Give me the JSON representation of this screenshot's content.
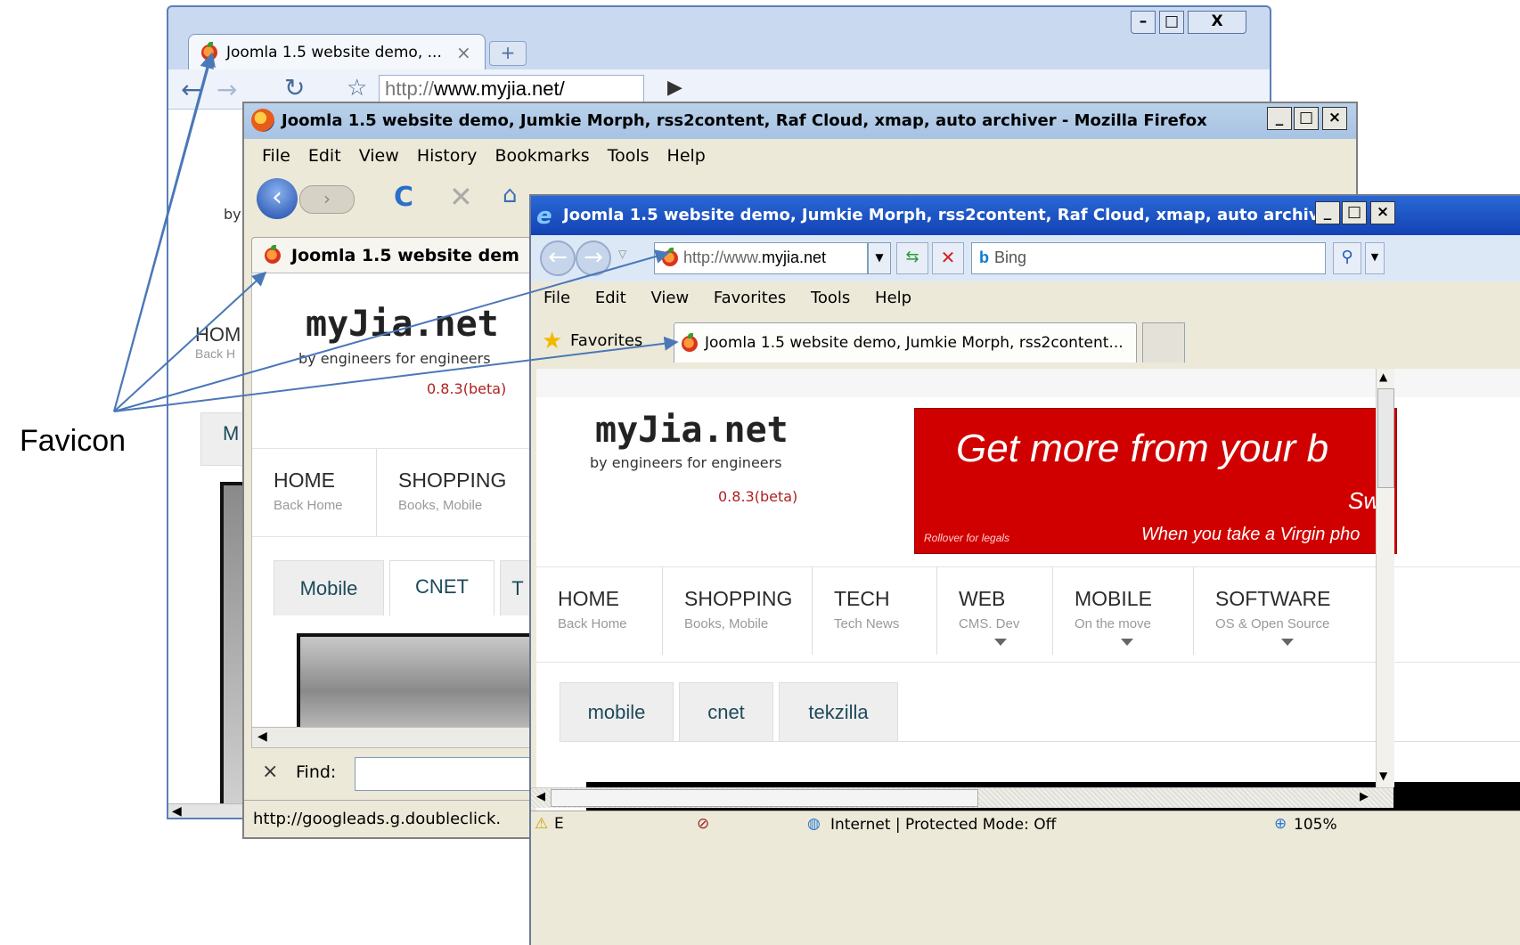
{
  "chrome": {
    "tab_title": "Joomla 1.5 website demo, ...",
    "tab_close": "×",
    "new_tab": "+",
    "url_prefix": "http://",
    "url_domain": "www.myjia.net/",
    "site_side_nav": "HOM",
    "site_side_sub": "Back H",
    "site_side_tab": "M",
    "site_by": "by",
    "controls": [
      "–",
      "□",
      "X"
    ]
  },
  "firefox": {
    "title": "Joomla 1.5 website demo, Jumkie Morph, rss2content, Raf Cloud, xmap, auto archiver - Mozilla Firefox",
    "menu": [
      "File",
      "Edit",
      "View",
      "History",
      "Bookmarks",
      "Tools",
      "Help"
    ],
    "tab_title": "Joomla 1.5 website dem",
    "site_logo": "myJia.net",
    "site_tagline": "by engineers for engineers",
    "site_version": "0.8.3(beta)",
    "nav": [
      {
        "title": "HOME",
        "sub": "Back Home"
      },
      {
        "title": "SHOPPING",
        "sub": "Books, Mobile"
      }
    ],
    "content_tabs": [
      "Mobile",
      "CNET",
      "T"
    ],
    "find_close": "×",
    "find_label": "Find:",
    "status": "http://googleads.g.doubleclick.",
    "controls": [
      "_",
      "□",
      "×"
    ]
  },
  "ie": {
    "title": "Joomla 1.5 website demo, Jumkie Morph, rss2content, Raf Cloud, xmap, auto archiv...",
    "address_prefix": "http://www.",
    "address_domain": "myjia.net",
    "search_placeholder": "Bing",
    "menu": [
      "File",
      "Edit",
      "View",
      "Favorites",
      "Tools",
      "Help"
    ],
    "favorites_label": "Favorites",
    "tab_title": "Joomla 1.5 website demo, Jumkie Morph, rss2content...",
    "site_logo": "myJia.net",
    "site_tagline": "by engineers for engineers",
    "site_version": "0.8.3(beta)",
    "ad_headline": "Get more from your b",
    "ad_sub": "Sw",
    "ad_legal": "Rollover for legals",
    "ad_tagline": "When  you take a Virgin pho",
    "nav": [
      {
        "title": "HOME",
        "sub": "Back Home",
        "arrow": false
      },
      {
        "title": "SHOPPING",
        "sub": "Books, Mobile",
        "arrow": false
      },
      {
        "title": "TECH",
        "sub": "Tech News",
        "arrow": false
      },
      {
        "title": "WEB",
        "sub": "CMS. Dev",
        "arrow": true
      },
      {
        "title": "MOBILE",
        "sub": "On the move",
        "arrow": true
      },
      {
        "title": "SOFTWARE",
        "sub": "OS & Open Source",
        "arrow": true
      }
    ],
    "content_tabs": [
      "mobile",
      "cnet",
      "tekzilla"
    ],
    "status_e": "E",
    "status_zone": "Internet | Protected Mode: Off",
    "zoom": "105%",
    "controls": [
      "_",
      "□",
      "×"
    ]
  },
  "annotation": {
    "label": "Favicon"
  }
}
